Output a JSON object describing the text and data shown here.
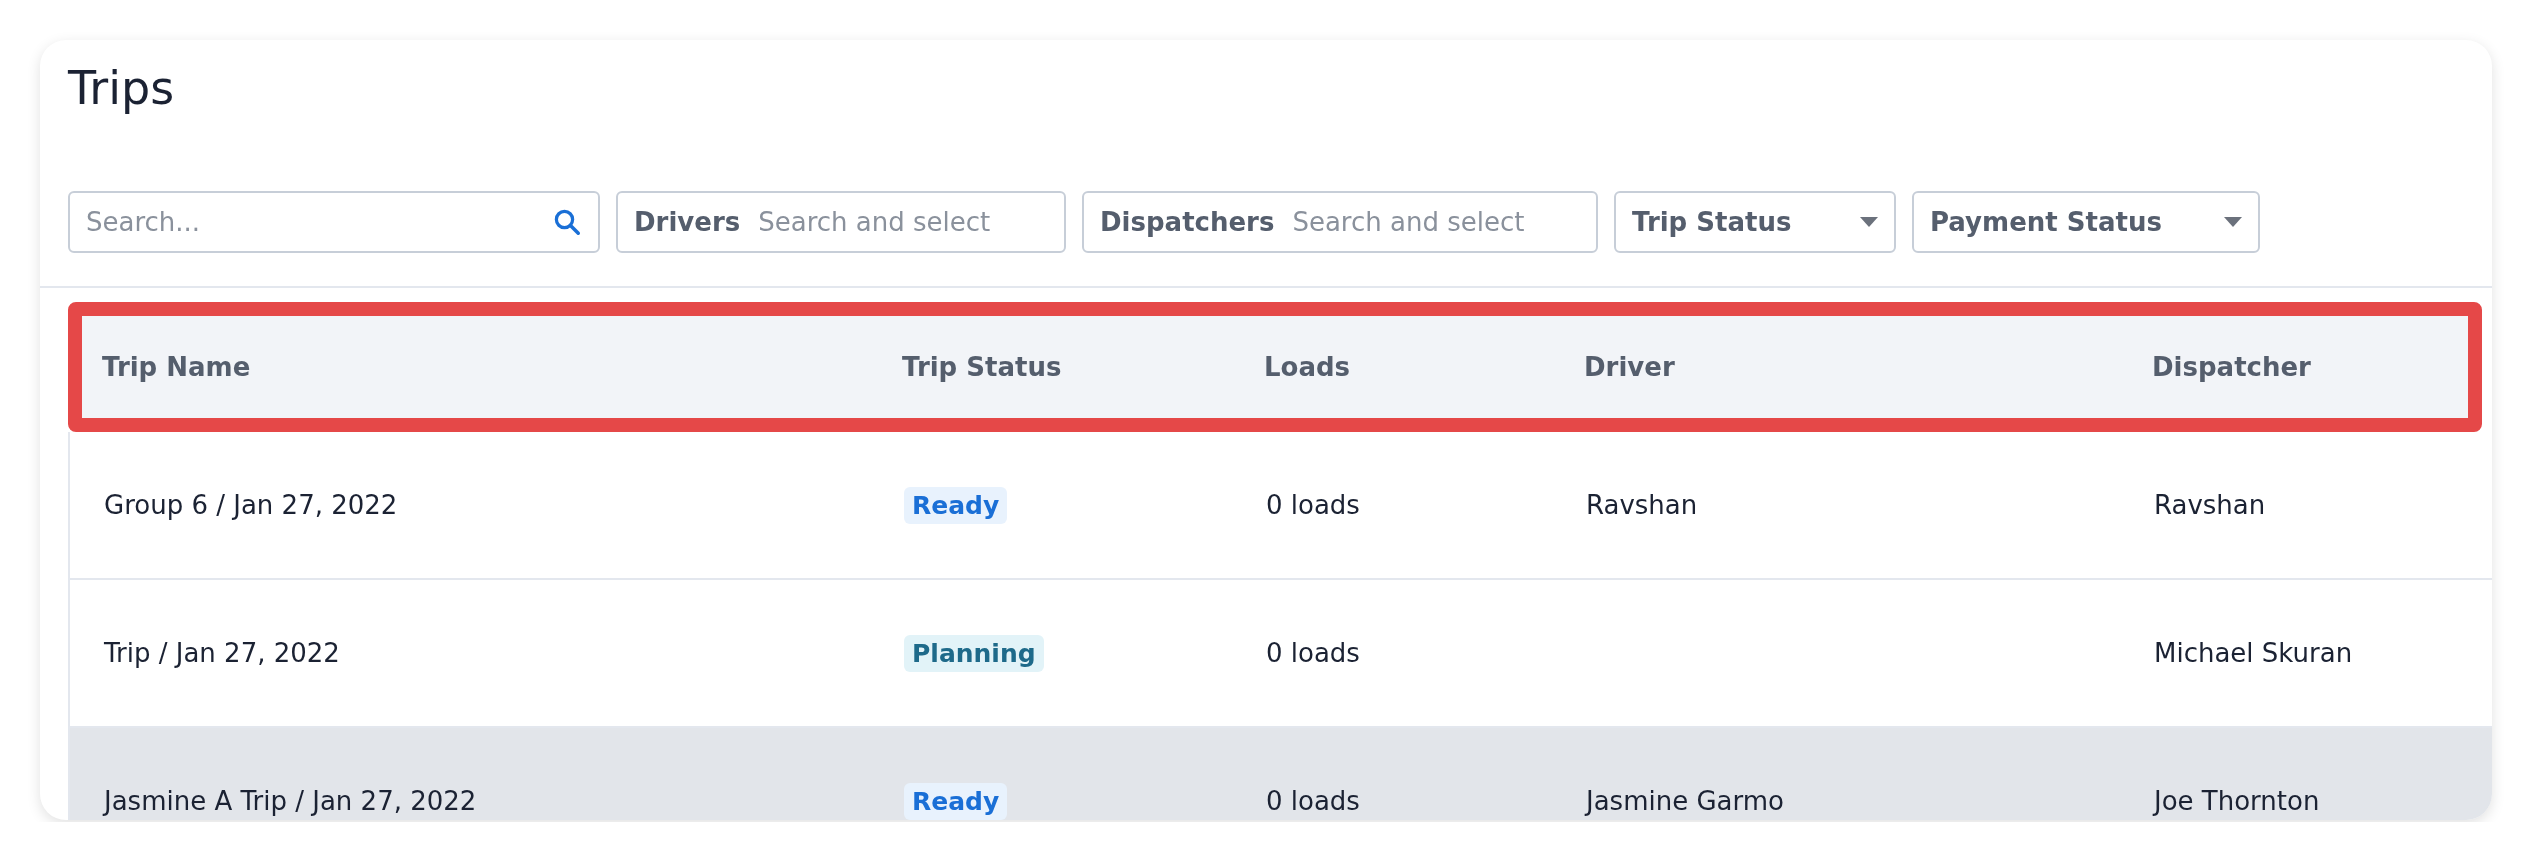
{
  "title": "Trips",
  "filters": [
    {
      "kind": "search",
      "placeholder": "Search..."
    },
    {
      "kind": "select",
      "label": "Drivers",
      "placeholder": "Search and select"
    },
    {
      "kind": "select",
      "label": "Dispatchers",
      "placeholder": "Search and select"
    },
    {
      "kind": "dropdown",
      "label": "Trip Status"
    },
    {
      "kind": "dropdown",
      "label": "Payment Status"
    }
  ],
  "table": {
    "header_highlighted": true,
    "columns": [
      "Trip Name",
      "Trip Status",
      "Loads",
      "Driver",
      "Dispatcher"
    ],
    "rows": [
      {
        "highlighted": false,
        "trip_name": "Group 6 / Jan 27, 2022",
        "status": {
          "label": "Ready",
          "kind": "ready"
        },
        "loads": "0 loads",
        "driver": "Ravshan",
        "dispatcher": "Ravshan"
      },
      {
        "highlighted": false,
        "trip_name": "Trip / Jan 27, 2022",
        "status": {
          "label": "Planning",
          "kind": "planning"
        },
        "loads": "0 loads",
        "dispatcher": "Michael Skuran"
      },
      {
        "highlighted": true,
        "trip_name": "Jasmine A Trip / Jan 27, 2022",
        "status": {
          "label": "Ready",
          "kind": "ready"
        },
        "loads": "0 loads",
        "driver": "Jasmine Garmo",
        "dispatcher": "Joe Thornton"
      }
    ]
  }
}
